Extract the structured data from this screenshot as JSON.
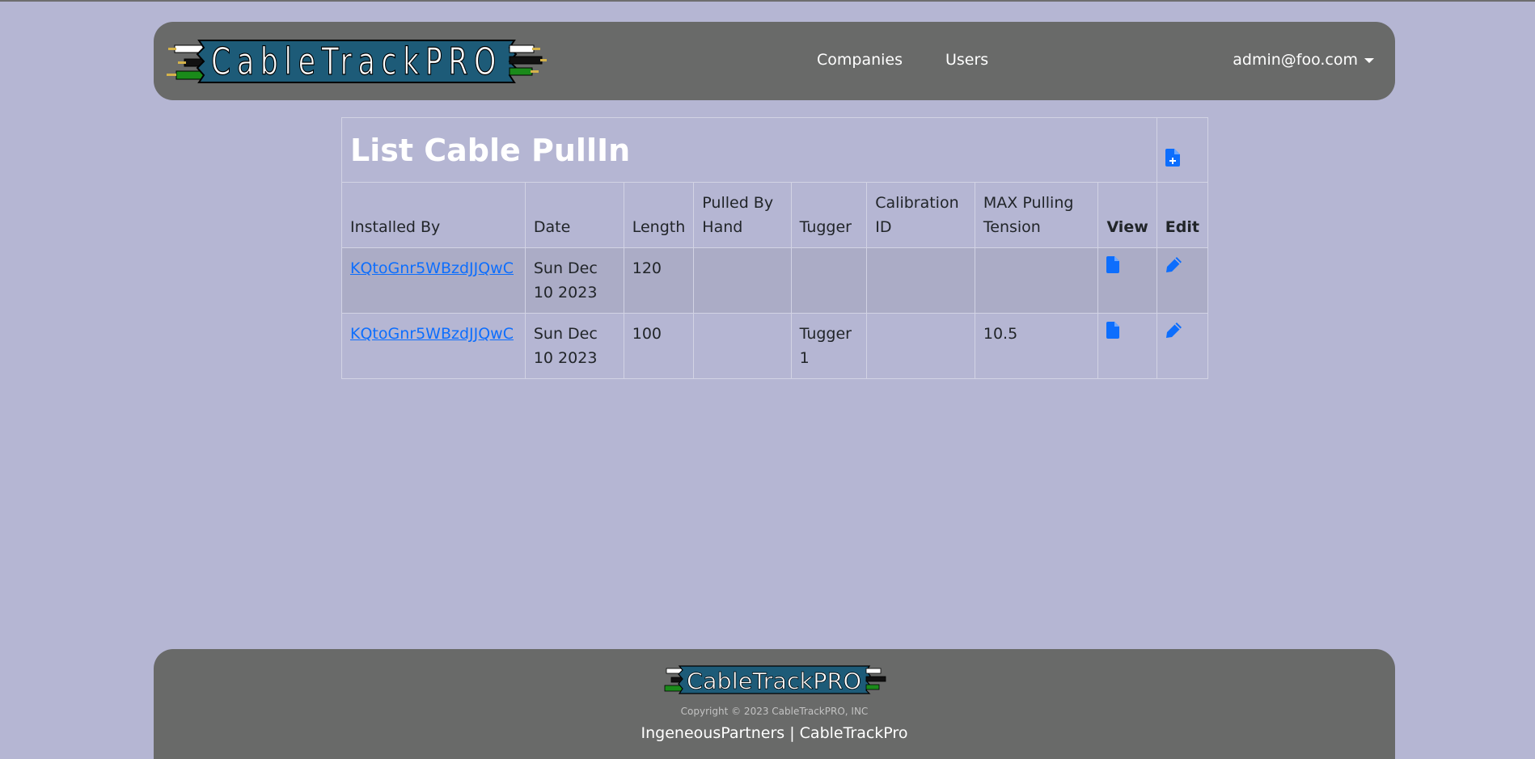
{
  "brand": {
    "name": "CableTrackPRO"
  },
  "nav": {
    "companies": "Companies",
    "users": "Users",
    "user_email": "admin@foo.com"
  },
  "page": {
    "title": "List Cable PullIn",
    "add_icon": "file-plus-icon"
  },
  "table": {
    "headers": {
      "installed_by": "Installed By",
      "date": "Date",
      "length": "Length",
      "pulled_by_hand": "Pulled By Hand",
      "tugger": "Tugger",
      "calibration_id": "Calibration ID",
      "max_pulling_tension": "MAX Pulling Tension",
      "view": "View",
      "edit": "Edit"
    },
    "rows": [
      {
        "installed_by": "KQtoGnr5WBzdJJQwC",
        "date": "Sun Dec 10 2023",
        "length": "120",
        "pulled_by_hand": "",
        "tugger": "",
        "calibration_id": "",
        "max_pulling_tension": ""
      },
      {
        "installed_by": "KQtoGnr5WBzdJJQwC",
        "date": "Sun Dec 10 2023",
        "length": "100",
        "pulled_by_hand": "",
        "tugger": "Tugger 1",
        "calibration_id": "",
        "max_pulling_tension": "10.5"
      }
    ],
    "view_icon": "file-icon",
    "edit_icon": "pencil-icon"
  },
  "footer": {
    "copyright": "Copyright © 2023 CableTrackPRO, INC",
    "links": "IngeneousPartners | CableTrackPro"
  },
  "colors": {
    "background": "#b5b6d3",
    "navbar": "#696a69",
    "link": "#0d6efd",
    "logo_banner": "#1d5b78"
  }
}
